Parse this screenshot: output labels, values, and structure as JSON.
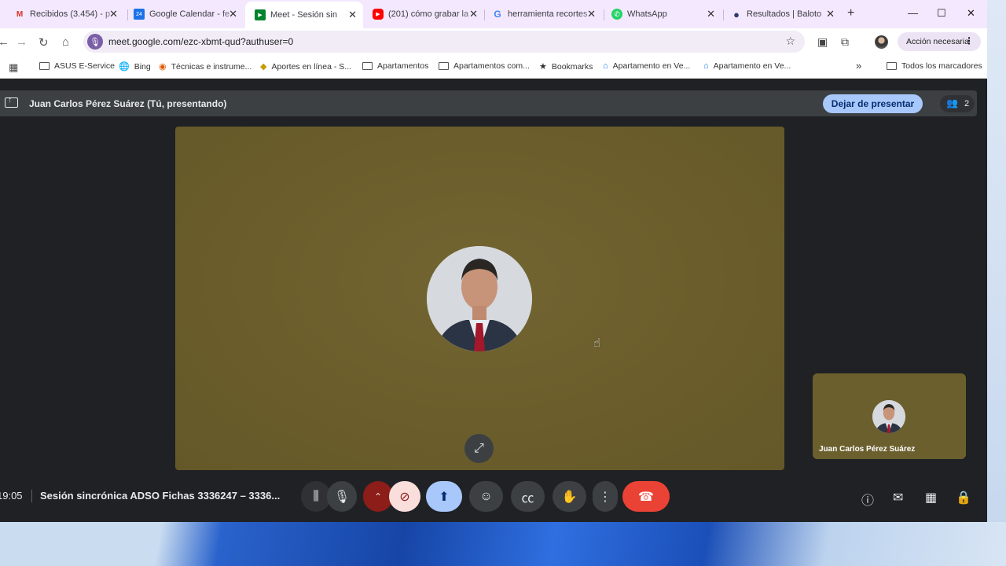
{
  "tabs": [
    {
      "title": "Recibidos (3.454) - p",
      "icon": "gmail-icon",
      "fav_glyph": "M",
      "fav_color": "#d93025"
    },
    {
      "title": "Google Calendar - fe",
      "icon": "calendar-icon",
      "fav_glyph": "24",
      "fav_color": "#1a73e8"
    },
    {
      "title": "Meet - Sesión sin",
      "icon": "meet-icon",
      "fav_glyph": "▶",
      "fav_color": "#00832d",
      "active": true
    },
    {
      "title": "(201) cómo grabar la",
      "icon": "youtube-icon",
      "fav_glyph": "▶",
      "fav_color": "#ff0000"
    },
    {
      "title": "herramienta recortes",
      "icon": "google-icon",
      "fav_glyph": "G",
      "fav_color": "#4285f4"
    },
    {
      "title": "WhatsApp",
      "icon": "whatsapp-icon",
      "fav_glyph": "✆",
      "fav_color": "#25d366"
    },
    {
      "title": "Resultados | Baloto",
      "icon": "baloto-icon",
      "fav_glyph": "●",
      "fav_color": "#2d3a6e"
    }
  ],
  "address": {
    "url": "meet.google.com/ezc-xbmt-qud?authuser=0"
  },
  "profile": {
    "action_label": "Acción necesaria"
  },
  "bookmarks": [
    {
      "label": "ASUS E-Service",
      "icon": "folder-icon"
    },
    {
      "label": "Bing",
      "icon": "globe-icon"
    },
    {
      "label": "Técnicas e instrume...",
      "icon": "site-icon"
    },
    {
      "label": "Aportes en línea - S...",
      "icon": "site-icon"
    },
    {
      "label": "Apartamentos",
      "icon": "folder-icon"
    },
    {
      "label": "Apartamentos com...",
      "icon": "folder-icon"
    },
    {
      "label": "Bookmarks",
      "icon": "star-icon"
    },
    {
      "label": "Apartamento en Ve...",
      "icon": "site-icon"
    },
    {
      "label": "Apartamento en Ve...",
      "icon": "site-icon"
    }
  ],
  "bookmarks_all": "Todos los marcadores",
  "meet": {
    "presenting_text": "Juan Carlos Pérez Suárez (Tú, presentando)",
    "stop_presenting": "Dejar de presentar",
    "participants_count": "2",
    "self_name": "Juan Carlos Pérez Suárez",
    "time": "19:05",
    "meeting_title": "Sesión sincrónica ADSO Fichas 3336247 – 3336..."
  },
  "colors": {
    "tile_bg": "#6b5f2d",
    "meet_bg": "#202124",
    "stop_btn": "#a8c7fa",
    "hangup": "#ea4335"
  }
}
